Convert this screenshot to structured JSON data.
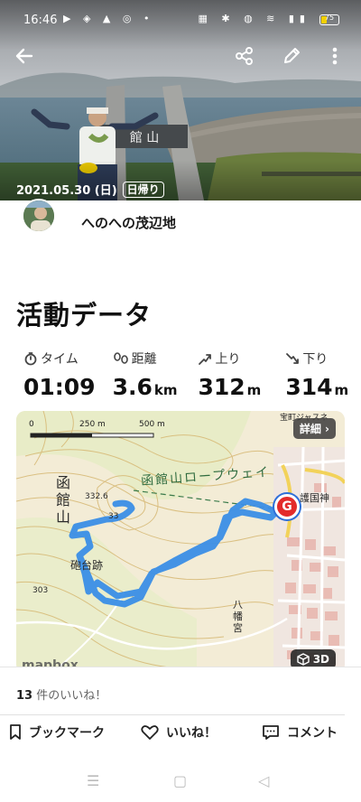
{
  "status_bar": {
    "time": "16:46",
    "left_icons": "▶ ◈ ▲ ◎ •",
    "right_icons": "▦ ✱ ◍ ≋ ▮▮",
    "battery": "75"
  },
  "topbar": {
    "back_icon": "arrow-left-icon",
    "share_icon": "share-icon",
    "edit_icon": "pencil-icon",
    "more_icon": "more-vertical-icon"
  },
  "activity": {
    "date": "2021.05.30 (日)",
    "trip_type": "日帰り",
    "author": "へのへの茂辺地"
  },
  "section_title": "活動データ",
  "stats": [
    {
      "icon": "stopwatch-icon",
      "label": "タイム",
      "value": "01:09",
      "unit": ""
    },
    {
      "icon": "footsteps-icon",
      "label": "距離",
      "value": "3.6",
      "unit": "km"
    },
    {
      "icon": "ascent-icon",
      "label": "上り",
      "value": "312",
      "unit": "m"
    },
    {
      "icon": "descent-icon",
      "label": "下り",
      "value": "314",
      "unit": "m"
    }
  ],
  "map": {
    "scale_labels": [
      "0",
      "250 m",
      "500 m"
    ],
    "detail_button": "詳細 ›",
    "button_3d": "3D",
    "goal_marker": "G",
    "mapbox_logo": "mapbox",
    "labels": {
      "ropeway": "函館山ロープウェイ",
      "mountain": "函館山",
      "battery_site": "砲台跡",
      "elev_332": "332.6",
      "elev_303": "303",
      "elev_33": "33",
      "hachiman": "八幡宮",
      "gokoku": "護国神",
      "top_right": "宝町ジャスネ"
    },
    "route_color": "#3a8ee6"
  },
  "bottom": {
    "likes_count": "13",
    "likes_text": " 件のいいね！",
    "bookmark": "ブックマーク",
    "like": "いいね！",
    "comment": "コメント"
  },
  "navbar": {
    "menu": "☰",
    "home": "▢",
    "back": "◁"
  }
}
